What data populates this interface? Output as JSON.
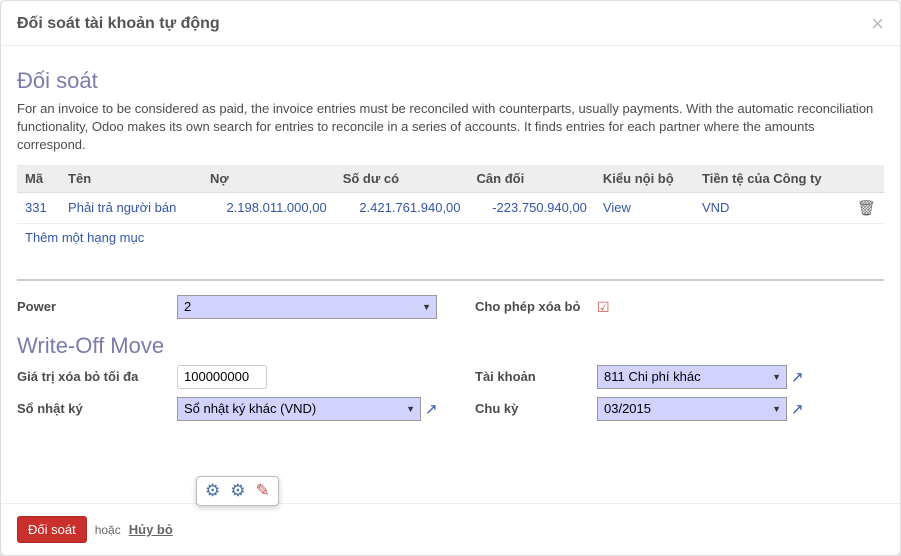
{
  "modal": {
    "title": "Đối soát tài khoản tự động",
    "close": "×"
  },
  "section": {
    "heading": "Đối soát",
    "description": "For an invoice to be considered as paid, the invoice entries must be reconciled with counterparts, usually payments. With the automatic reconciliation functionality, Odoo makes its own search for entries to reconcile in a series of accounts. It finds entries for each partner where the amounts correspond."
  },
  "table": {
    "headers": {
      "code": "Mã",
      "name": "Tên",
      "debit": "Nợ",
      "credit": "Số dư có",
      "balance": "Cân đối",
      "internal_type": "Kiểu nội bộ",
      "currency": "Tiền tệ của Công ty"
    },
    "rows": [
      {
        "code": "331",
        "name": "Phải trả người bán",
        "debit": "2.198.011.000,00",
        "credit": "2.421.761.940,00",
        "balance": "-223.750.940,00",
        "internal_type": "View",
        "currency": "VND"
      }
    ],
    "add_item": "Thêm một hạng mục"
  },
  "form": {
    "power_label": "Power",
    "power_value": "2",
    "allow_writeoff_label": "Cho phép xóa bỏ",
    "writeoff_heading": "Write-Off Move",
    "max_writeoff_label": "Giá trị xóa bỏ tối đa",
    "max_writeoff_value": "100000000",
    "account_label": "Tài khoản",
    "account_value": "811 Chi phí khác",
    "journal_label": "Sổ nhật ký",
    "journal_value": "Sổ nhật ký khác (VND)",
    "period_label": "Chu kỳ",
    "period_value": "03/2015"
  },
  "footer": {
    "reconcile": "Đối soát",
    "or": "hoặc",
    "cancel": "Hủy bỏ"
  }
}
